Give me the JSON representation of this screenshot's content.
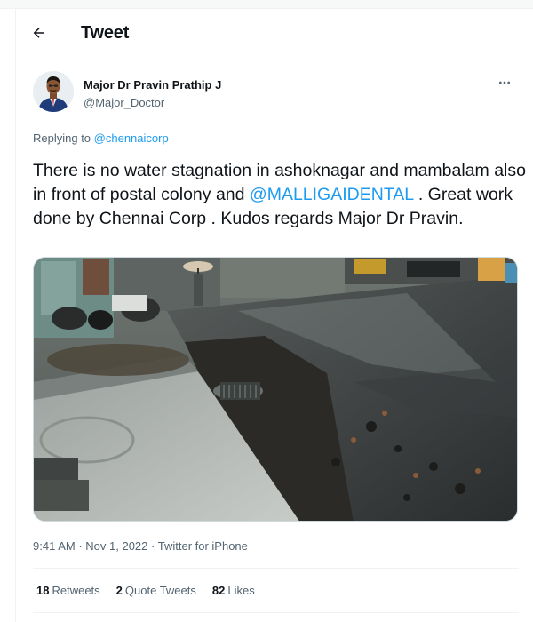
{
  "header": {
    "title": "Tweet"
  },
  "author": {
    "name": "Major Dr Pravin Prathip J",
    "handle": "@Major_Doctor"
  },
  "replying": {
    "prefix": "Replying to",
    "mention": "@chennaicorp"
  },
  "tweet": {
    "text_part1": "There is no water stagnation in ashoknagar and mambalam also in front of postal colony and ",
    "mention": "@MALLIGAIDENTAL",
    "text_part2": " . Great work done by Chennai Corp . Kudos regards Major Dr Pravin."
  },
  "meta": {
    "time": "9:41 AM",
    "date": "Nov 1, 2022",
    "source": "Twitter for iPhone"
  },
  "stats": {
    "retweets_count": "18",
    "retweets_label": "Retweets",
    "quotes_count": "2",
    "quotes_label": "Quote Tweets",
    "likes_count": "82",
    "likes_label": "Likes"
  },
  "colors": {
    "link": "#1d9bf0",
    "text": "#0f1419",
    "muted": "#536471"
  },
  "icons": {
    "back": "arrow-left-icon",
    "more": "more-horizontal-icon"
  }
}
